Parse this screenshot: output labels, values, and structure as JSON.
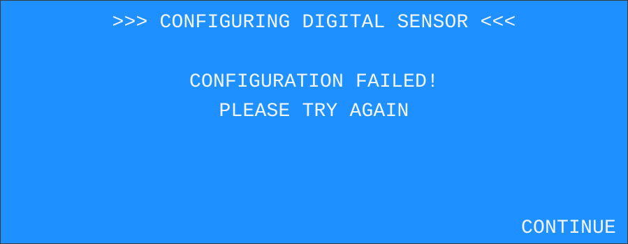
{
  "screen": {
    "title": ">>> CONFIGURING DIGITAL SENSOR <<<",
    "message_line1": "CONFIGURATION FAILED!",
    "message_line2": "PLEASE TRY AGAIN",
    "continue_label": "CONTINUE"
  },
  "colors": {
    "background": "#1e90ff",
    "text": "#f2f6fb",
    "border": "#3a3a3a"
  }
}
